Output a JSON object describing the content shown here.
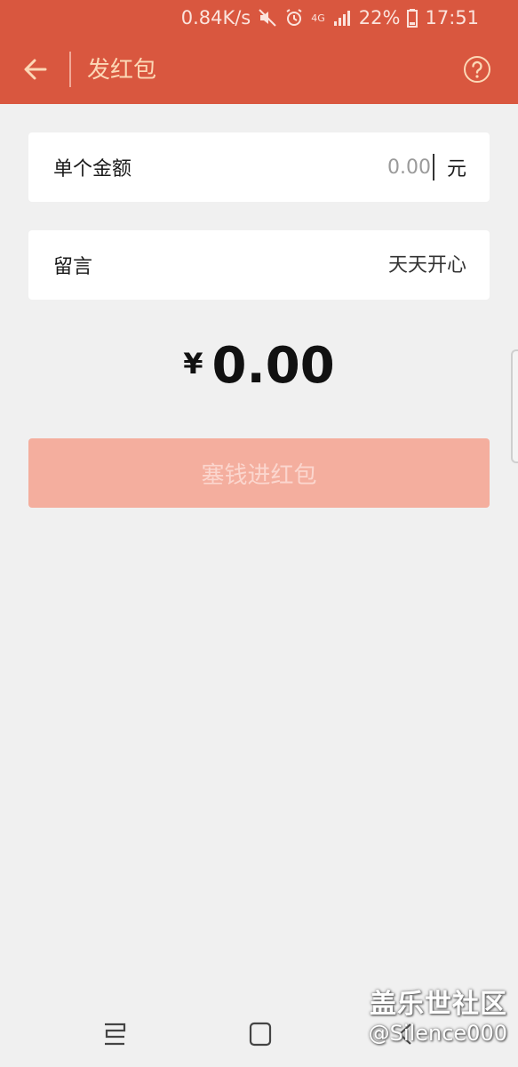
{
  "status_bar": {
    "speed": "0.84K/s",
    "network": "4G",
    "battery": "22%",
    "time": "17:51",
    "icons": [
      "mute-icon",
      "alarm-icon",
      "network-4g-icon",
      "signal-icon",
      "battery-icon"
    ]
  },
  "header": {
    "title": "发红包",
    "back_icon": "back-arrow-icon",
    "help_icon": "help-icon"
  },
  "amount": {
    "label": "单个金额",
    "placeholder": "0.00",
    "unit": "元"
  },
  "message": {
    "label": "留言",
    "placeholder": "天天开心"
  },
  "total": {
    "currency": "¥",
    "value": "0.00"
  },
  "submit": {
    "label": "塞钱进红包"
  },
  "nav": {
    "icons": [
      "recent-apps-icon",
      "home-icon",
      "back-icon"
    ]
  },
  "watermark": {
    "title": "盖乐世社区",
    "user": "@Silence000"
  },
  "colors": {
    "header": "#d9573f",
    "header_text": "#fcd8b6",
    "button": "#f4ae9e",
    "button_text": "#fbd6ce",
    "background": "#f0f0f0"
  }
}
